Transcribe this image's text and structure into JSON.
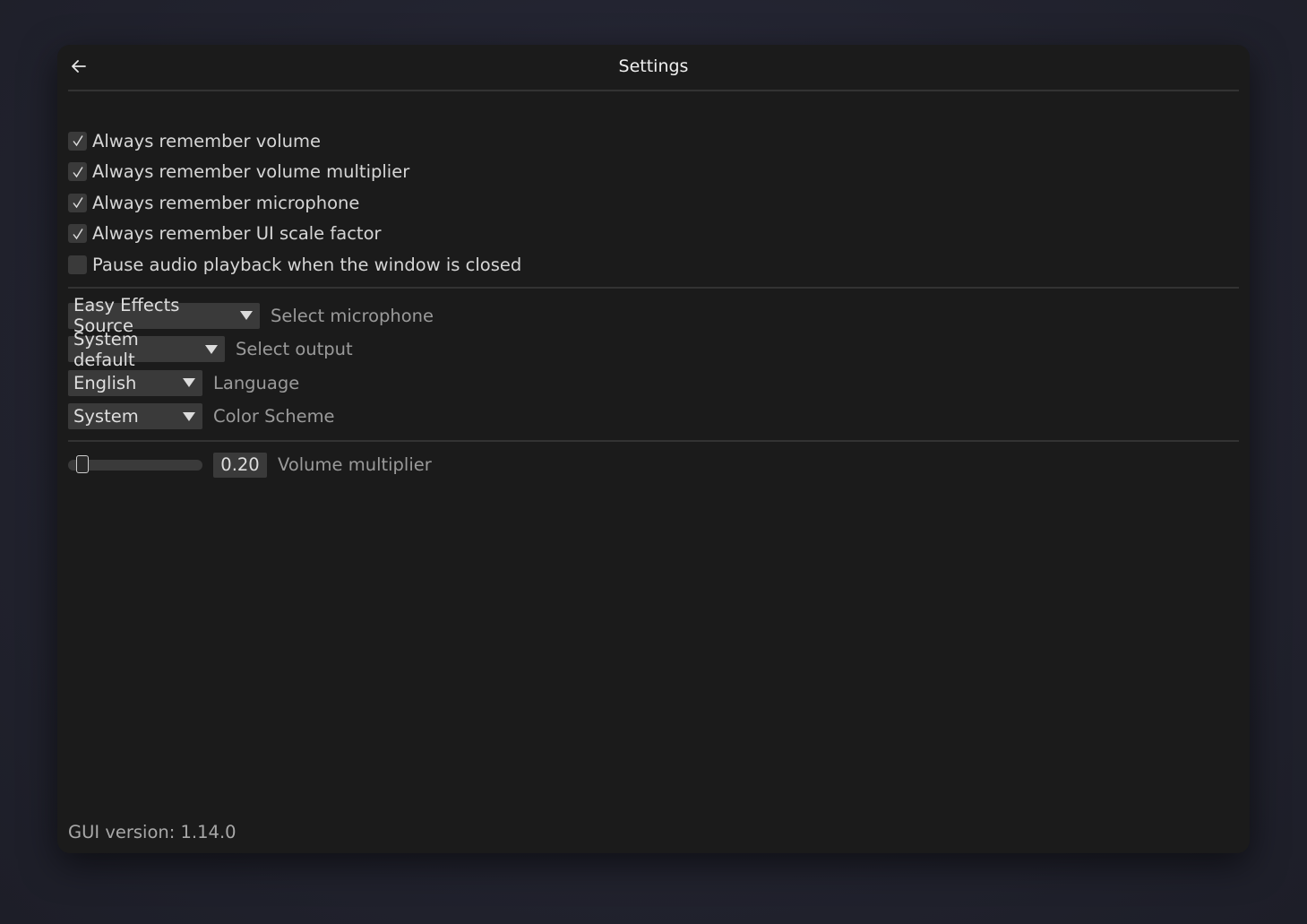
{
  "window": {
    "title": "Settings"
  },
  "checkboxes": [
    {
      "label": "Always remember volume",
      "checked": true
    },
    {
      "label": "Always remember volume multiplier",
      "checked": true
    },
    {
      "label": "Always remember microphone",
      "checked": true
    },
    {
      "label": "Always remember UI scale factor",
      "checked": true
    },
    {
      "label": "Pause audio playback when the window is closed",
      "checked": false
    }
  ],
  "combos": [
    {
      "value": "Easy Effects Source",
      "label": "Select microphone"
    },
    {
      "value": "System default",
      "label": "Select output"
    },
    {
      "value": "English",
      "label": "Language"
    },
    {
      "value": "System",
      "label": "Color Scheme"
    }
  ],
  "slider": {
    "value": "0.20",
    "label": "Volume multiplier",
    "fraction": 0.05
  },
  "footer": {
    "version_text": "GUI version: 1.14.0"
  },
  "icons": {
    "back": "arrow-left-icon",
    "check": "checkmark-icon",
    "dropdown": "triangle-down-icon"
  }
}
